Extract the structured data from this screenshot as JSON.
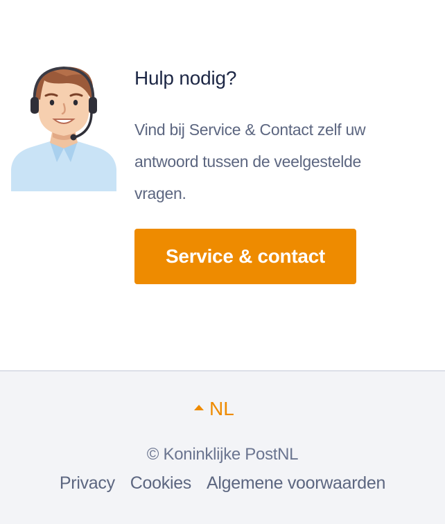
{
  "help": {
    "title": "Hulp nodig?",
    "text": "Vind bij Service & Contact zelf uw antwoord tussen de veelgestelde vragen.",
    "button_label": "Service & contact",
    "avatar_icon": "customer-service-agent-headset"
  },
  "footer": {
    "language": "NL",
    "language_caret_icon": "caret-up-icon",
    "copyright": "© Koninklijke PostNL",
    "links": [
      {
        "label": "Privacy"
      },
      {
        "label": "Cookies"
      },
      {
        "label": "Algemene voorwaarden"
      }
    ]
  },
  "colors": {
    "accent": "#ee8b00",
    "title": "#1d2745",
    "body_text": "#5c6680",
    "footer_bg": "#f3f4f7"
  }
}
